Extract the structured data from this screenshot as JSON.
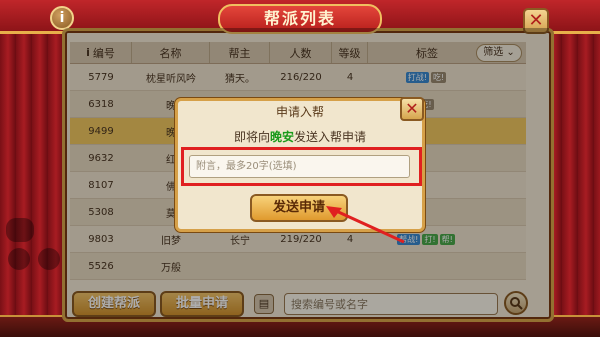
{
  "window": {
    "title": "帮派列表"
  },
  "table": {
    "headers": [
      "编号",
      "名称",
      "帮主",
      "人数",
      "等级",
      "标签"
    ],
    "filter_label": "筛选",
    "rows": [
      {
        "id": "5779",
        "name": "枕星听风吟",
        "leader": "猜天。",
        "count": "216/220",
        "level": "4",
        "tags": [
          "打战!",
          "吃!"
        ]
      },
      {
        "id": "6318",
        "name": "晚",
        "leader": "",
        "count": "",
        "level": "",
        "tags": [
          "吃!"
        ]
      },
      {
        "id": "9499",
        "name": "晚",
        "leader": "",
        "count": "",
        "level": "",
        "tags": []
      },
      {
        "id": "9632",
        "name": "红",
        "leader": "",
        "count": "",
        "level": "",
        "tags": []
      },
      {
        "id": "8107",
        "name": "佛",
        "leader": "",
        "count": "",
        "level": "",
        "tags": []
      },
      {
        "id": "5308",
        "name": "莫",
        "leader": "",
        "count": "",
        "level": "",
        "tags": []
      },
      {
        "id": "9803",
        "name": "旧梦",
        "leader": "长宁",
        "count": "219/220",
        "level": "4",
        "tags": [
          "帮战!",
          "打!",
          "帮!"
        ]
      },
      {
        "id": "5526",
        "name": "万般",
        "leader": "",
        "count": "",
        "level": "",
        "tags": []
      }
    ]
  },
  "bottom": {
    "create_label": "创建帮派",
    "batch_label": "批量申请",
    "search_placeholder": "搜索编号或名字"
  },
  "dialog": {
    "title": "申请入帮",
    "msg_prefix": "即将向",
    "msg_highlight": "晚安",
    "msg_suffix": "发送入帮申请",
    "note_placeholder": "附言，最多20字(选填)",
    "send_label": "发送申请"
  },
  "colors": {
    "highlight": "#1a9a1a",
    "annotation": "#e02020",
    "accent": "#d6a048"
  }
}
